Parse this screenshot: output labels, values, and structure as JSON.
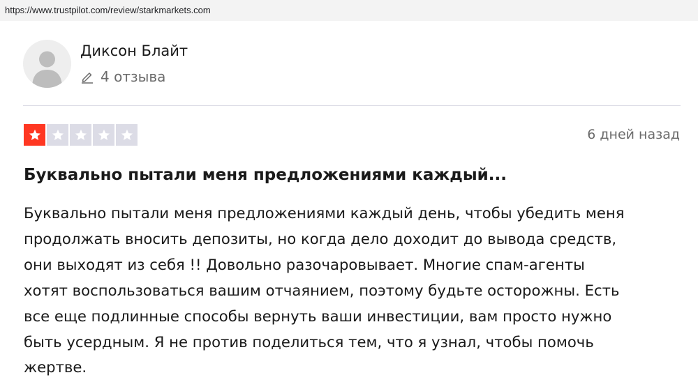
{
  "browser": {
    "url": "https://www.trustpilot.com/review/starkmarkets.com"
  },
  "reviewer": {
    "name": "Диксон Блайт",
    "review_count": "4 отзыва",
    "avatar_icon": "user-silhouette-icon"
  },
  "review": {
    "rating": 1,
    "rating_max": 5,
    "star_color_filled": "#ff3722",
    "star_color_empty": "#dcdce6",
    "date": "6 дней назад",
    "title": "Буквально пытали меня предложениями каждый...",
    "body_lines": [
      "Буквально пытали меня предложениями каждый день, чтобы убедить меня",
      "продолжать вносить депозиты, но когда дело доходит до вывода средств,",
      "они выходят из себя !! Довольно разочаровывает. Многие спам-агенты",
      "хотят воспользоваться вашим отчаянием, поэтому будьте осторожны. Есть",
      "все еще подлинные способы вернуть ваши инвестиции, вам просто нужно",
      "быть усердным. Я не против поделиться тем, что я узнал, чтобы помочь",
      "жертве."
    ]
  }
}
